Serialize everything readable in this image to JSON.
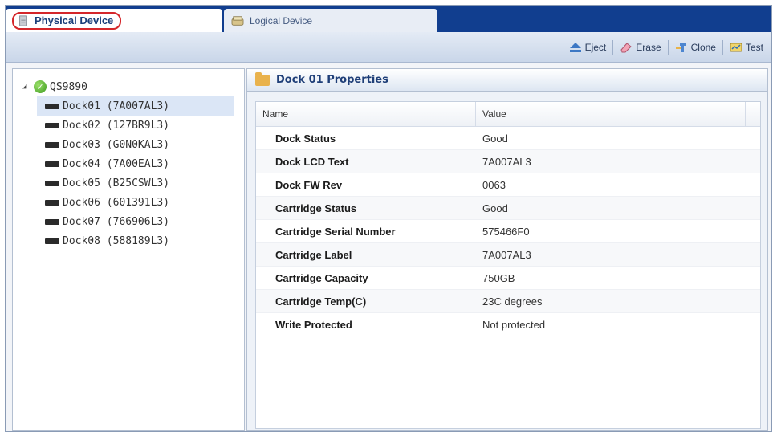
{
  "tabs": {
    "physical": "Physical Device",
    "logical": "Logical Device"
  },
  "toolbar": {
    "eject": "Eject",
    "erase": "Erase",
    "clone": "Clone",
    "test": "Test"
  },
  "tree": {
    "root": "QS9890",
    "items": [
      {
        "label": "Dock01 (7A007AL3)"
      },
      {
        "label": "Dock02 (127BR9L3)"
      },
      {
        "label": "Dock03 (G0N0KAL3)"
      },
      {
        "label": "Dock04 (7A00EAL3)"
      },
      {
        "label": "Dock05 (B25CSWL3)"
      },
      {
        "label": "Dock06 (601391L3)"
      },
      {
        "label": "Dock07 (766906L3)"
      },
      {
        "label": "Dock08 (588189L3)"
      }
    ]
  },
  "properties": {
    "title": "Dock 01 Properties",
    "columns": {
      "name": "Name",
      "value": "Value"
    },
    "rows": [
      {
        "name": "Dock Status",
        "value": "Good"
      },
      {
        "name": "Dock LCD Text",
        "value": "7A007AL3"
      },
      {
        "name": "Dock FW Rev",
        "value": "0063"
      },
      {
        "name": "Cartridge Status",
        "value": "Good"
      },
      {
        "name": "Cartridge Serial Number",
        "value": "575466F0"
      },
      {
        "name": "Cartridge Label",
        "value": "7A007AL3"
      },
      {
        "name": "Cartridge Capacity",
        "value": "750GB"
      },
      {
        "name": "Cartridge Temp(C)",
        "value": "23C degrees"
      },
      {
        "name": "Write Protected",
        "value": "Not protected"
      }
    ]
  },
  "colors": {
    "tab_strip": "#113e8f",
    "highlight_ring": "#d4262a",
    "selection": "#dbe6f6",
    "status_ok": "#3d9a1e"
  }
}
